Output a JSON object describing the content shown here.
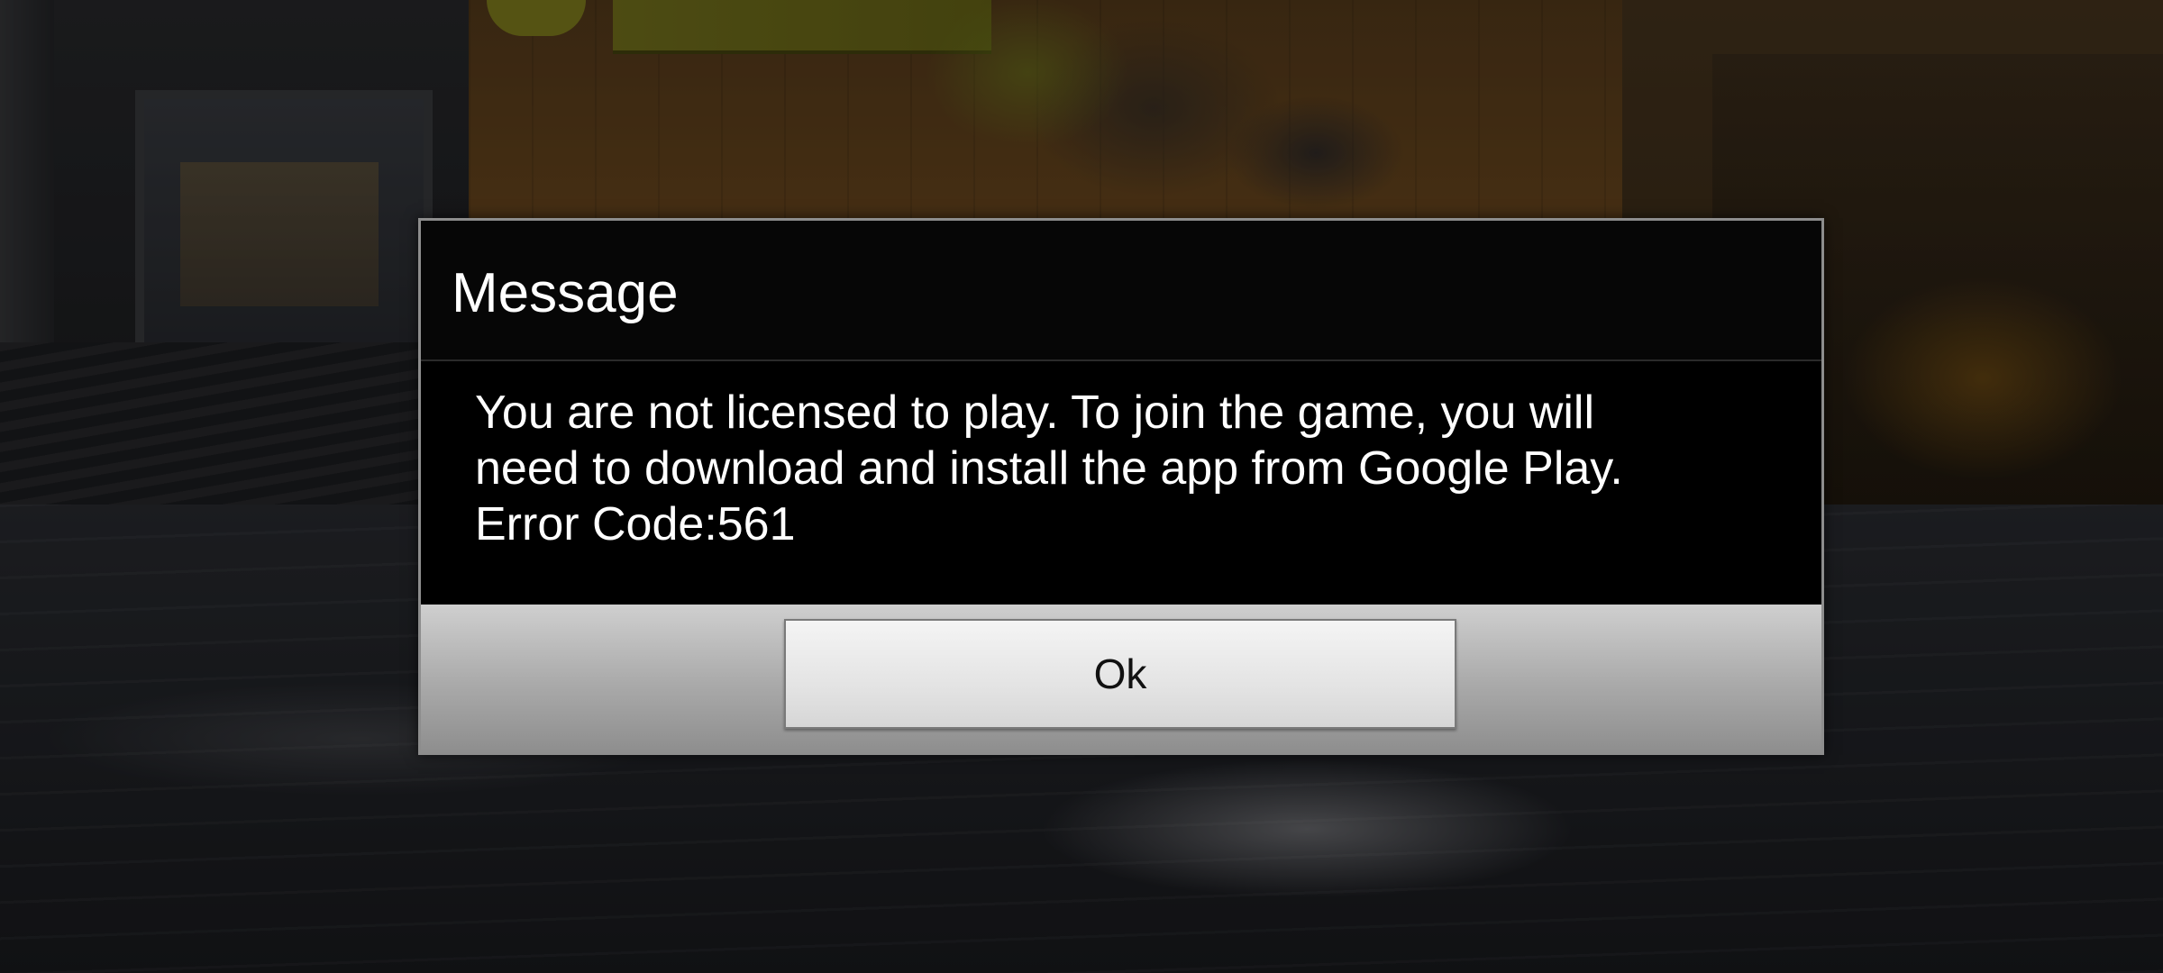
{
  "dialog": {
    "title": "Message",
    "message": "You are not licensed to play. To join the game, you will\nneed to download and install the app from Google Play.\nError Code:561",
    "ok_label": "Ok"
  },
  "colors": {
    "dialog_background": "#000000",
    "dialog_text": "#ffffff",
    "footer_gradient_top": "#cfcfcf",
    "footer_gradient_bottom": "#8e8e8e",
    "button_background": "#e4e4e4",
    "button_text": "#111111"
  }
}
